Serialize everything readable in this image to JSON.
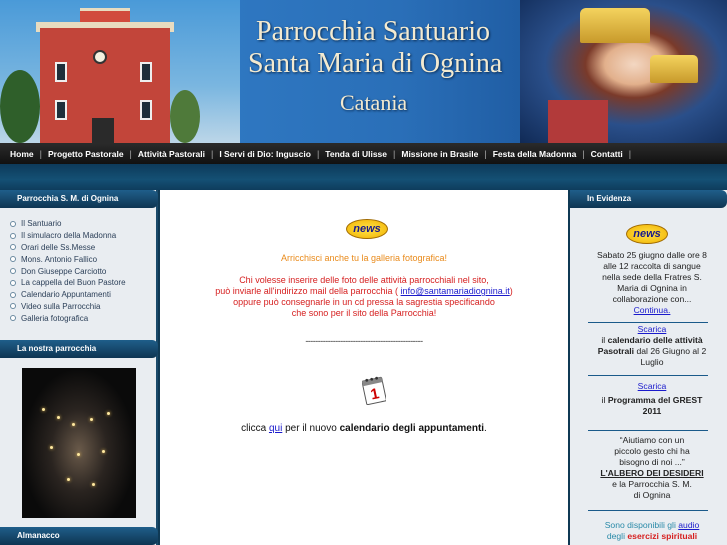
{
  "header": {
    "title_line1": "Parrocchia Santuario",
    "title_line2": "Santa Maria di Ognina",
    "title_line3": "Catania"
  },
  "nav": {
    "items": [
      "Home",
      "Progetto Pastorale",
      "Attività Pastorali",
      "I Servi di Dio: Inguscio",
      "Tenda di Ulisse",
      "Missione in Brasile",
      "Festa della Madonna",
      "Contatti"
    ]
  },
  "left": {
    "section1_title": "Parrocchia S. M. di Ognina",
    "menu": [
      "Il Santuario",
      "Il simulacro della Madonna",
      "Orari delle Ss.Messe",
      "Mons. Antonio Fallico",
      "Don Giuseppe Carciotto",
      "La cappella del Buon Pastore",
      "Calendario Appuntamenti",
      "Video sulla Parrocchia",
      "Galleria fotografica"
    ],
    "section2_title": "La nostra parrocchia",
    "section3_title": "Almanacco"
  },
  "center": {
    "news_badge": "news",
    "gallery_headline": "Arricchisci anche tu la galleria fotografica!",
    "gallery_text1": "Chi volesse inserire delle foto delle attività parrocchiali nel sito,",
    "gallery_text2_pre": "può inviarle all'indirizzo mail della parrocchia (",
    "gallery_email": "info@santamariadiognina.it",
    "gallery_text2_post": ")",
    "gallery_text3": "oppure può consegnarle in un cd pressa la sagrestia specificando",
    "gallery_text4": "che sono per il sito della Parrocchia!",
    "divider": "-----------------------------------------------",
    "calendar_icon_number": "1",
    "cal_pre": "clicca",
    "cal_link": "qui",
    "cal_mid": "per il nuovo",
    "cal_bold": "calendario degli appuntamenti",
    "cal_end": "."
  },
  "right": {
    "title": "In Evidenza",
    "news_badge": "news",
    "item1_lines": [
      "Sabato 25 giugno dalle ore 8",
      "alle 12 raccolta di sangue",
      "nella sede della Fratres S.",
      "Maria di Ognina in",
      "collaborazione con..."
    ],
    "item1_link": "Continua.",
    "item2_link": "Scarica",
    "item2_pre": "il",
    "item2_bold1": "calendario delle attività",
    "item2_bold2": "Pasotrali",
    "item2_rest": "dal 26 Giugno al 2",
    "item2_end": "Luglio",
    "item3_link": "Scarica",
    "item3_pre": "il",
    "item3_bold1": "Programma del GREST",
    "item3_bold2": "2011",
    "item4_lines": [
      "“Aiutiamo con un",
      "piccolo gesto chi ha",
      "bisogno di noi ...”"
    ],
    "item4_bold": "L'ALBERO DEI DESIDERI",
    "item4_rest1": "e la Parrocchia S. M.",
    "item4_rest2": "di Ognina",
    "item5_pre": "Sono disponibili gli",
    "item5_link": "audio",
    "item5_pre2": "degli",
    "item5_red": "esercizi spirituali"
  }
}
